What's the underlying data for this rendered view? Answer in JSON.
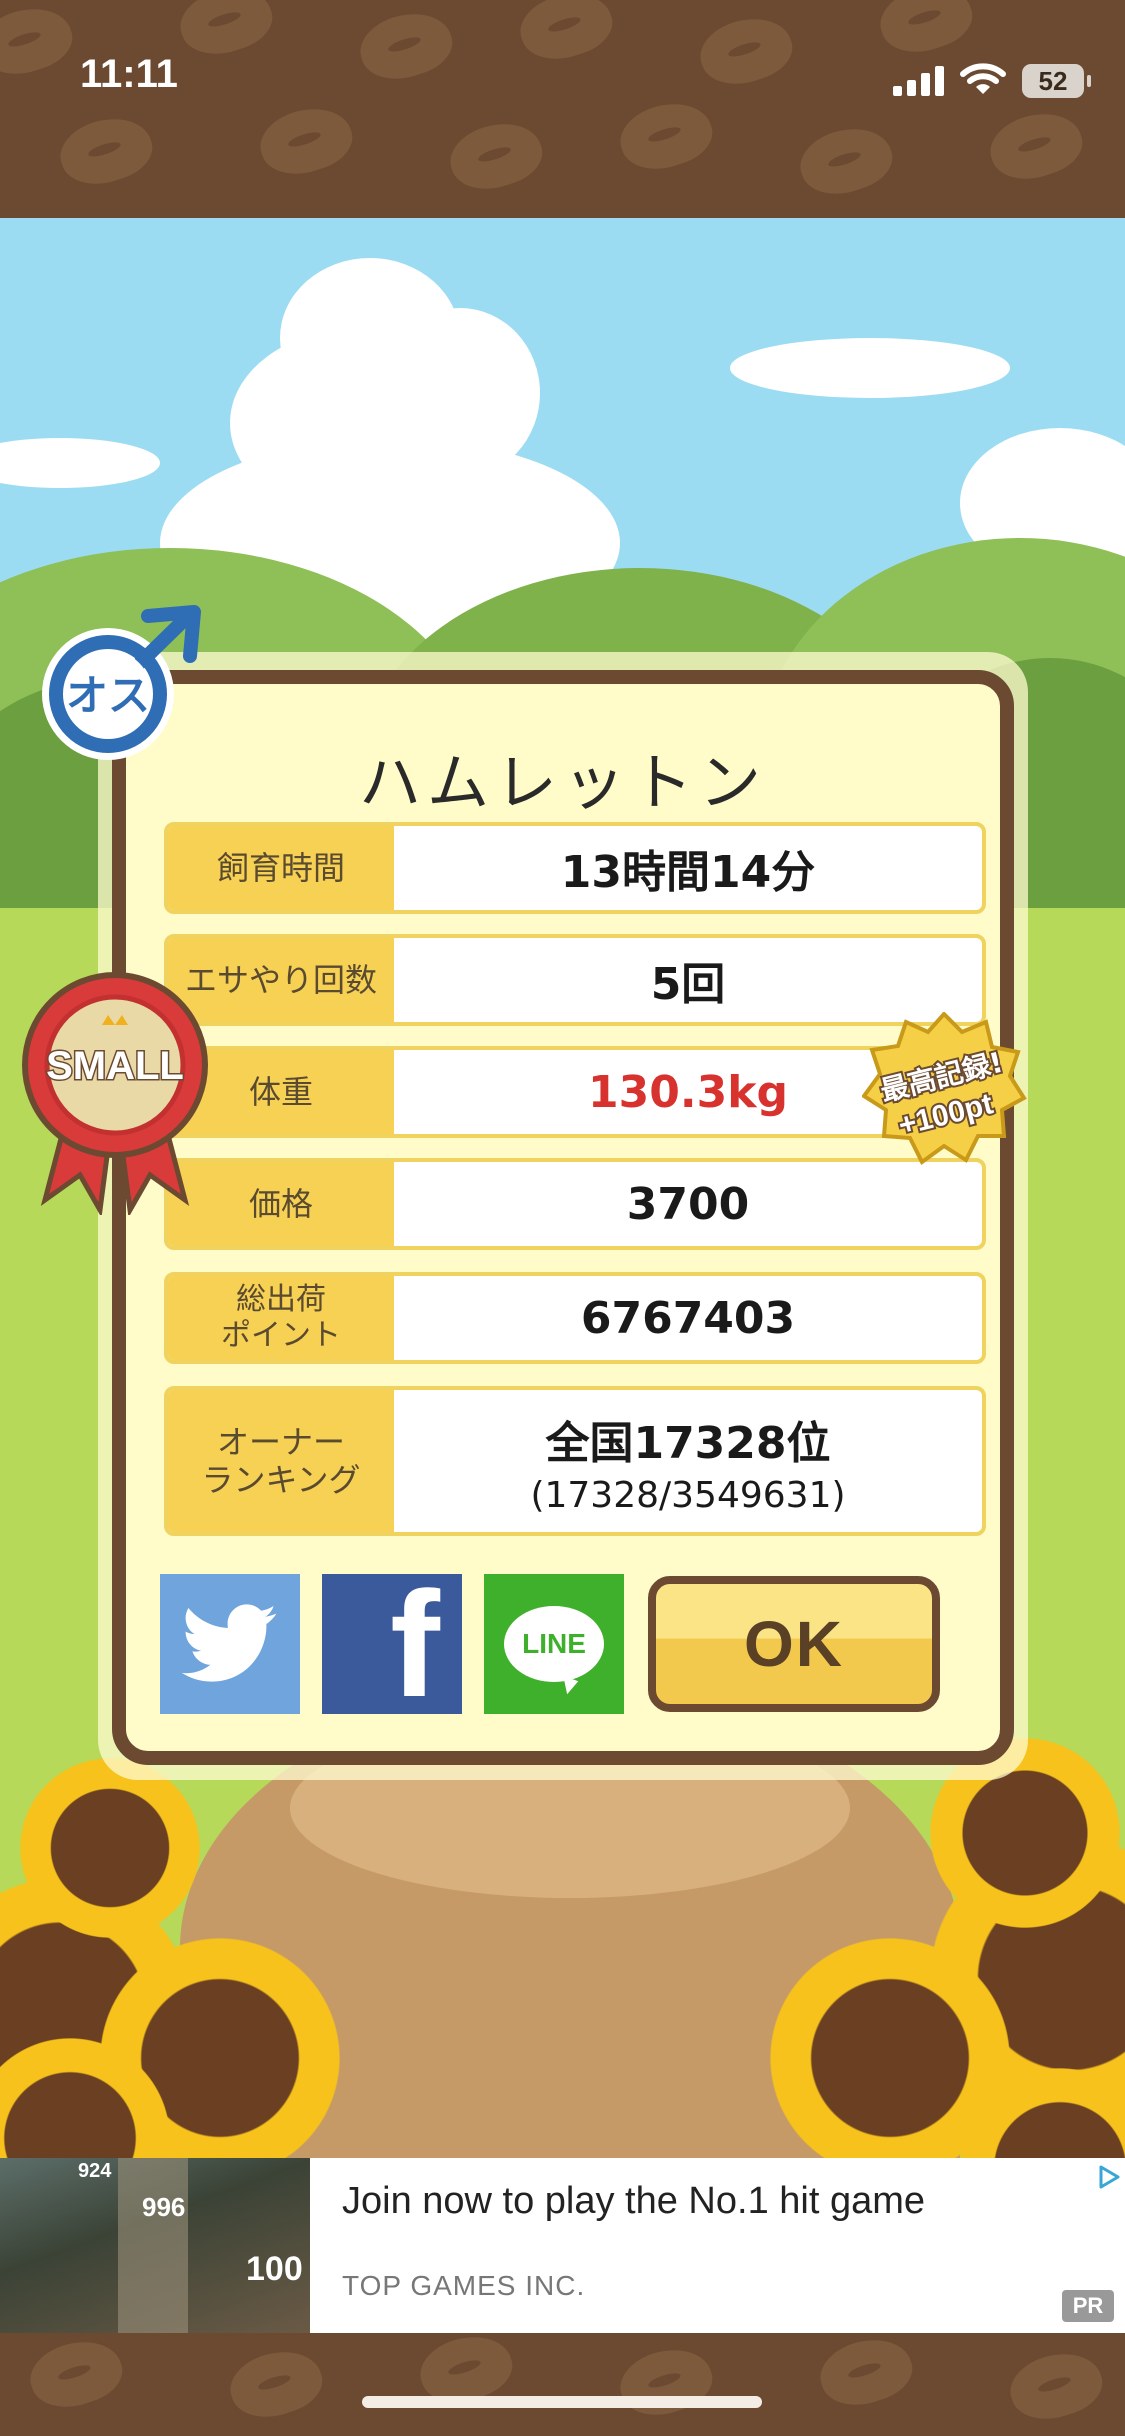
{
  "status_bar": {
    "time": "11:11",
    "battery": "52"
  },
  "dialog": {
    "pet_name": "ハムレットン",
    "stats": [
      {
        "label": "飼育時間",
        "value": "13時間14分"
      },
      {
        "label": "エサやり回数",
        "value": "5回"
      },
      {
        "label": "体重",
        "value": "130.3kg",
        "color": "#d8322f"
      },
      {
        "label": "価格",
        "value": "3700"
      },
      {
        "label": "総出荷\nポイント",
        "value": "6767403"
      },
      {
        "label": "オーナー\nランキング",
        "value": "全国17328位",
        "sub": "(17328/3549631)"
      }
    ],
    "share": {
      "twitter_icon": "twitter-bird-icon",
      "facebook_glyph": "f",
      "line_label": "LINE"
    },
    "ok_label": "OK"
  },
  "badges": {
    "gender": "オス",
    "size": "SMALL",
    "record_line1": "最高記録!",
    "record_line2": "+100pt"
  },
  "ad": {
    "title": "Join now to play the No.1 hit game",
    "sponsor": "TOP GAMES INC.",
    "pr": "PR",
    "thumb_numbers": [
      "924",
      "996",
      "100"
    ]
  },
  "colors": {
    "brown": "#6b4a31",
    "dialog_bg": "#fffcc9",
    "label_yellow": "#f7d154",
    "highlight_red": "#d8322f",
    "twitter": "#6fa4dc",
    "facebook": "#3b5a9b",
    "line": "#3fb02b"
  }
}
